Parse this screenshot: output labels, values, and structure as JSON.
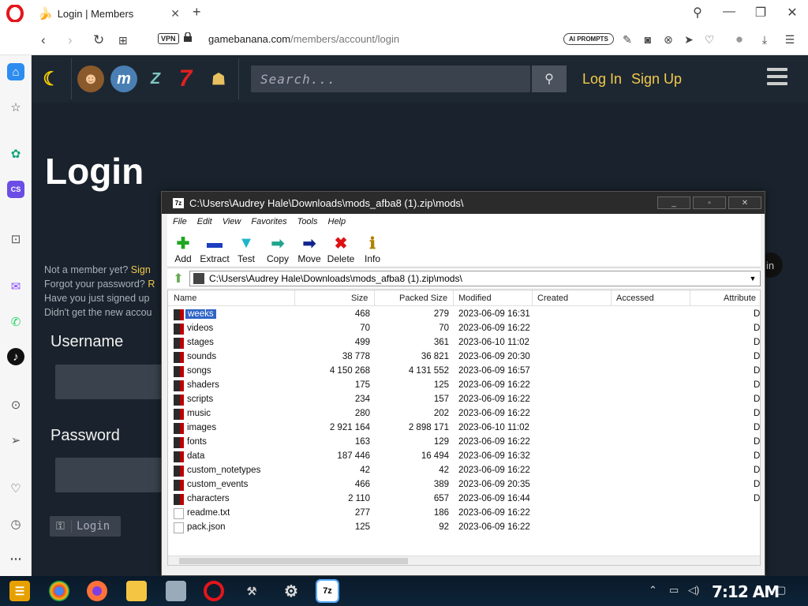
{
  "browser": {
    "tab_title": "Login | Members",
    "url_host": "gamebanana.com",
    "url_path": "/members/account/login",
    "vpn_label": "VPN",
    "ai_prompts_label": "AI PROMPTS"
  },
  "site": {
    "search_placeholder": "Search...",
    "login_link": "Log In",
    "signup_link": "Sign Up",
    "page_title": "Login",
    "help_1_text": "Not a member yet?",
    "help_1_link": "Sign",
    "help_2_text": "Forgot your password?",
    "help_2_link": "R",
    "help_3_text": "Have you just signed up",
    "help_4_text": "Didn't get the new accou",
    "username_label": "Username",
    "password_label": "Password",
    "login_button": "Login",
    "right_pill": "in"
  },
  "zip": {
    "title": "C:\\Users\\Audrey Hale\\Downloads\\mods_afba8 (1).zip\\mods\\",
    "menu": [
      "File",
      "Edit",
      "View",
      "Favorites",
      "Tools",
      "Help"
    ],
    "toolbar": [
      "Add",
      "Extract",
      "Test",
      "Copy",
      "Move",
      "Delete",
      "Info"
    ],
    "address": "C:\\Users\\Audrey Hale\\Downloads\\mods_afba8 (1).zip\\mods\\",
    "columns": [
      "Name",
      "Size",
      "Packed Size",
      "Modified",
      "Created",
      "Accessed",
      "Attribute"
    ],
    "rows": [
      {
        "name": "weeks",
        "size": "468",
        "packed": "279",
        "modified": "2023-06-09 16:31",
        "attr": "D",
        "type": "folder",
        "selected": true
      },
      {
        "name": "videos",
        "size": "70",
        "packed": "70",
        "modified": "2023-06-09 16:22",
        "attr": "D",
        "type": "folder"
      },
      {
        "name": "stages",
        "size": "499",
        "packed": "361",
        "modified": "2023-06-10 11:02",
        "attr": "D",
        "type": "folder"
      },
      {
        "name": "sounds",
        "size": "38 778",
        "packed": "36 821",
        "modified": "2023-06-09 20:30",
        "attr": "D",
        "type": "folder"
      },
      {
        "name": "songs",
        "size": "4 150 268",
        "packed": "4 131 552",
        "modified": "2023-06-09 16:57",
        "attr": "D",
        "type": "folder"
      },
      {
        "name": "shaders",
        "size": "175",
        "packed": "125",
        "modified": "2023-06-09 16:22",
        "attr": "D",
        "type": "folder"
      },
      {
        "name": "scripts",
        "size": "234",
        "packed": "157",
        "modified": "2023-06-09 16:22",
        "attr": "D",
        "type": "folder"
      },
      {
        "name": "music",
        "size": "280",
        "packed": "202",
        "modified": "2023-06-09 16:22",
        "attr": "D",
        "type": "folder"
      },
      {
        "name": "images",
        "size": "2 921 164",
        "packed": "2 898 171",
        "modified": "2023-06-10 11:02",
        "attr": "D",
        "type": "folder"
      },
      {
        "name": "fonts",
        "size": "163",
        "packed": "129",
        "modified": "2023-06-09 16:22",
        "attr": "D",
        "type": "folder"
      },
      {
        "name": "data",
        "size": "187 446",
        "packed": "16 494",
        "modified": "2023-06-09 16:32",
        "attr": "D",
        "type": "folder"
      },
      {
        "name": "custom_notetypes",
        "size": "42",
        "packed": "42",
        "modified": "2023-06-09 16:22",
        "attr": "D",
        "type": "folder"
      },
      {
        "name": "custom_events",
        "size": "466",
        "packed": "389",
        "modified": "2023-06-09 20:35",
        "attr": "D",
        "type": "folder"
      },
      {
        "name": "characters",
        "size": "2 110",
        "packed": "657",
        "modified": "2023-06-09 16:44",
        "attr": "D",
        "type": "folder"
      },
      {
        "name": "readme.txt",
        "size": "277",
        "packed": "186",
        "modified": "2023-06-09 16:22",
        "attr": "",
        "type": "file"
      },
      {
        "name": "pack.json",
        "size": "125",
        "packed": "92",
        "modified": "2023-06-09 16:22",
        "attr": "",
        "type": "file"
      }
    ]
  },
  "taskbar": {
    "clock": "7:12 AM",
    "sevenzip_label": "7z"
  }
}
